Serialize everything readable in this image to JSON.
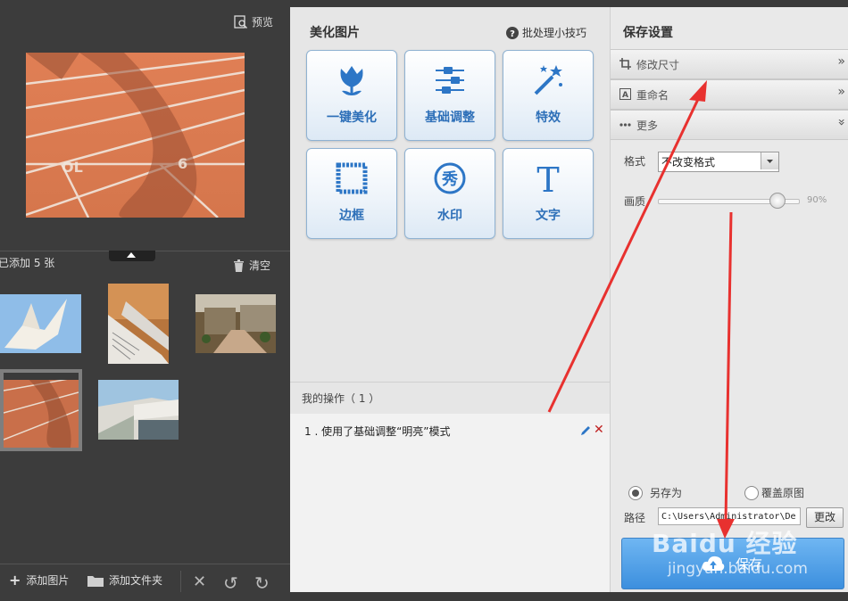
{
  "left": {
    "preview_label": "预览",
    "added_count": "已添加 5 张",
    "clear_label": "清空",
    "thumbnails": [
      "origami-crane",
      "book-pages",
      "building-corridor",
      "running-track",
      "building-balcony"
    ],
    "bottom": {
      "add_image": "添加图片",
      "add_folder": "添加文件夹"
    }
  },
  "middle": {
    "title": "美化图片",
    "batch_tips": "批处理小技巧",
    "tools": [
      {
        "label": "一键美化",
        "icon": "tulip-icon"
      },
      {
        "label": "基础调整",
        "icon": "sliders-icon"
      },
      {
        "label": "特效",
        "icon": "magic-wand-icon"
      },
      {
        "label": "边框",
        "icon": "frame-icon"
      },
      {
        "label": "水印",
        "icon": "watermark-stamp-icon"
      },
      {
        "label": "文字",
        "icon": "text-T-icon"
      }
    ],
    "ops_title": "我的操作（ 1 ）",
    "ops": [
      "1 . 使用了基础调整“明亮”模式"
    ]
  },
  "right": {
    "title": "保存设置",
    "accordion": [
      {
        "label": "修改尺寸",
        "icon": "crop-icon",
        "chevron": "»"
      },
      {
        "label": "重命名",
        "icon": "rename-icon",
        "chevron": "»"
      },
      {
        "label": "更多",
        "icon": "more-dots-icon",
        "chevron": "»"
      }
    ],
    "format_label": "格式",
    "format_value": "不改变格式",
    "quality_label": "画质",
    "quality_value": "90%",
    "quality_fraction": 0.9,
    "save_as": "另存为",
    "overwrite": "覆盖原图",
    "path_label": "路径",
    "path_value": "C:\\Users\\Administrator\\De",
    "change_button": "更改",
    "save_button": "保存"
  },
  "watermark": {
    "main": "Baidu 经验",
    "sub": "jingyan.baidu.com"
  },
  "colors": {
    "accent_blue": "#2d6fb8",
    "save_blue": "#3c8fde",
    "annotation_red": "#e8312f",
    "left_bg": "#3c3c3c"
  }
}
